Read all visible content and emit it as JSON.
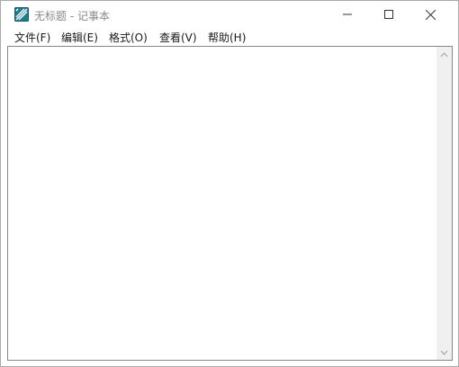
{
  "window": {
    "title": "无标题 - 记事本"
  },
  "menu": {
    "items": [
      "文件(F)",
      "编辑(E)",
      "格式(O)",
      "查看(V)",
      "帮助(H)"
    ]
  },
  "editor": {
    "content": ""
  },
  "icons": {
    "app": "notepad-icon",
    "minimize": "minimize-icon",
    "maximize": "maximize-icon",
    "close": "close-icon",
    "scroll_up": "chevron-up-icon",
    "scroll_down": "chevron-down-icon"
  },
  "colors": {
    "app_icon": "#1f7c8c",
    "scrollbar": "#f0f0f0",
    "title_text": "#888888"
  }
}
